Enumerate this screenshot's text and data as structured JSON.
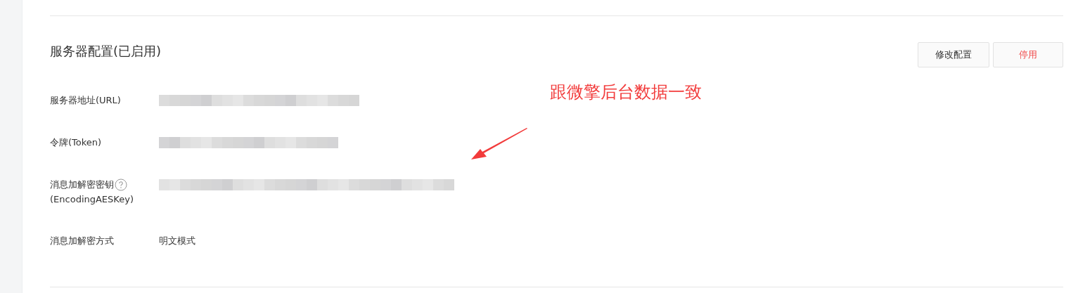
{
  "section": {
    "title": "服务器配置(已启用)",
    "buttons": [
      {
        "label": "修改配置",
        "kind": "default"
      },
      {
        "label": "停用",
        "kind": "danger"
      }
    ]
  },
  "fields": [
    {
      "label": "服务器地址(URL)",
      "kind": "redacted",
      "help": false
    },
    {
      "label": "令牌(Token)",
      "kind": "redacted",
      "help": false
    },
    {
      "label": "消息加解密密钥",
      "label_2": "(EncodingAESKey)",
      "kind": "redacted",
      "help": true
    },
    {
      "label": "消息加解密方式",
      "kind": "text",
      "value": "明文模式",
      "help": false
    }
  ],
  "annotation": {
    "text": "跟微擎后台数据一致"
  }
}
